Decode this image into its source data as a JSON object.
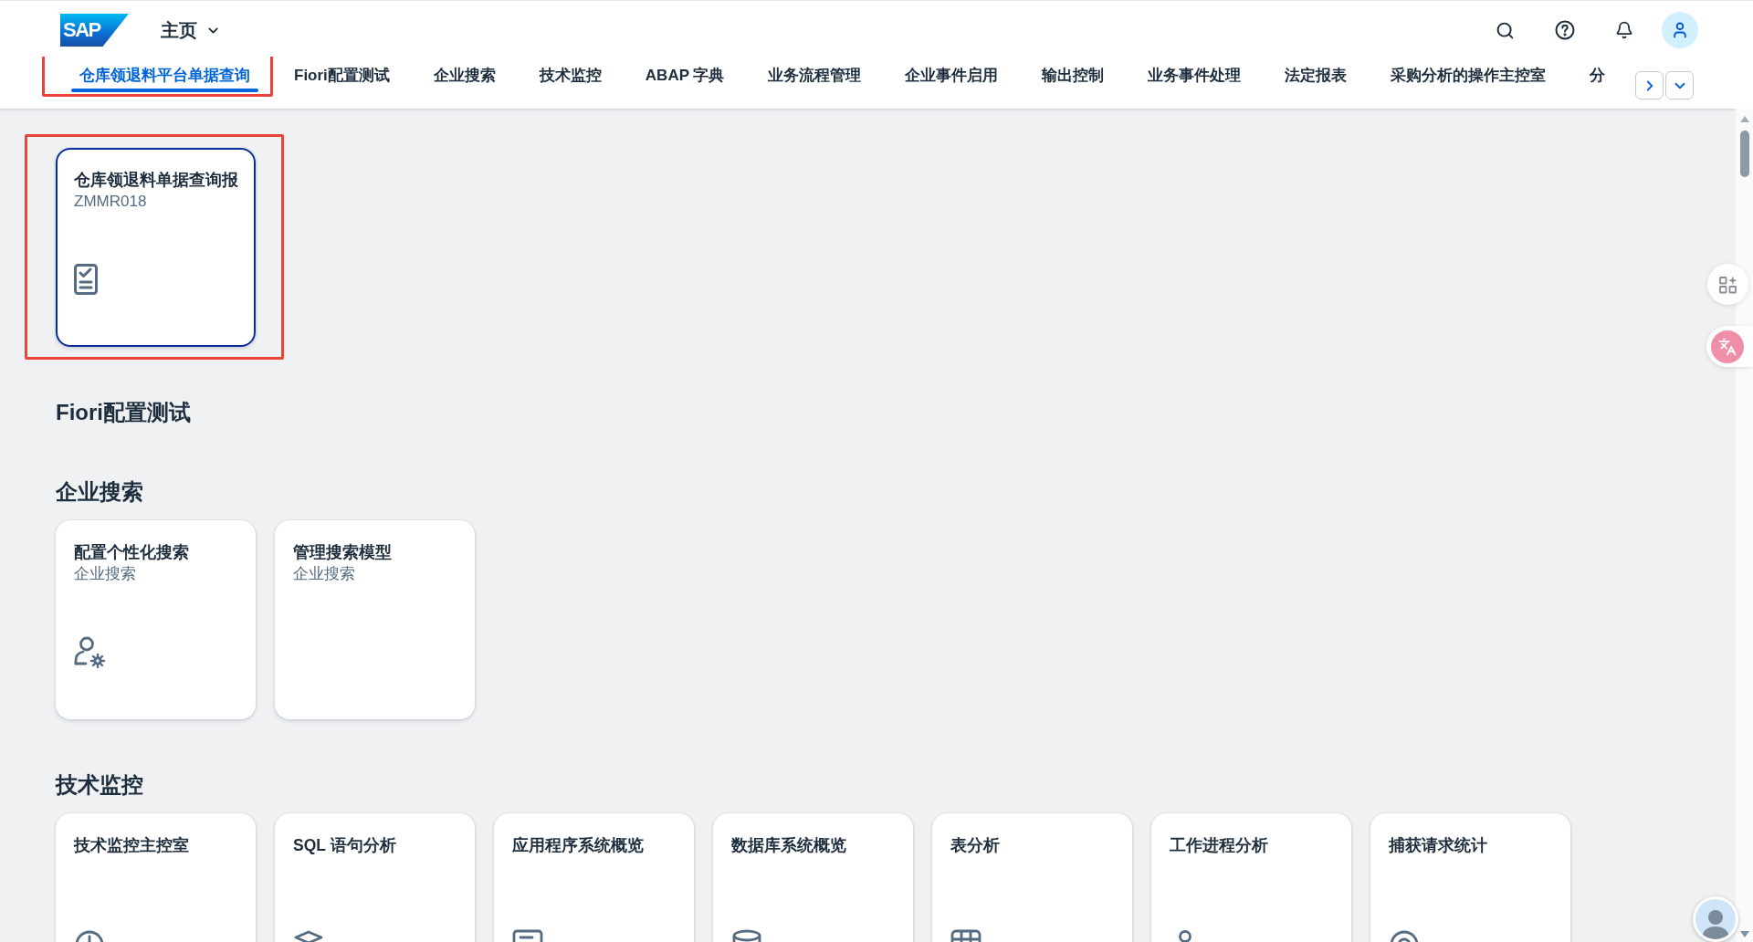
{
  "shell_bar": {
    "logo": "SAP",
    "title": "主页"
  },
  "tabs": [
    {
      "label": "仓库领退料平台单据查询",
      "selected": true,
      "highlighted": true
    },
    {
      "label": "Fiori配置测试",
      "selected": false,
      "highlighted": false
    },
    {
      "label": "企业搜索",
      "selected": false,
      "highlighted": false
    },
    {
      "label": "技术监控",
      "selected": false,
      "highlighted": false
    },
    {
      "label": "ABAP 字典",
      "selected": false,
      "highlighted": false
    },
    {
      "label": "业务流程管理",
      "selected": false,
      "highlighted": false
    },
    {
      "label": "企业事件启用",
      "selected": false,
      "highlighted": false
    },
    {
      "label": "输出控制",
      "selected": false,
      "highlighted": false
    },
    {
      "label": "业务事件处理",
      "selected": false,
      "highlighted": false
    },
    {
      "label": "法定报表",
      "selected": false,
      "highlighted": false
    },
    {
      "label": "采购分析的操作主控室",
      "selected": false,
      "highlighted": false
    },
    {
      "label": "分",
      "selected": false,
      "highlighted": false
    }
  ],
  "sections": [
    {
      "tiles": [
        {
          "title": "仓库领退料单据查询报",
          "subtitle": "ZMMR018",
          "focused": true,
          "highlighted": true
        }
      ]
    },
    {
      "title": "Fiori配置测试"
    },
    {
      "title": "企业搜索",
      "tiles": [
        {
          "title": "配置个性化搜索",
          "subtitle": "企业搜索",
          "focused": false,
          "highlighted": false
        },
        {
          "title": "管理搜索模型",
          "subtitle": "企业搜索",
          "focused": false,
          "highlighted": false
        }
      ]
    },
    {
      "title": "技术监控",
      "tiles": [
        {
          "title": "技术监控主控室",
          "focused": false,
          "highlighted": false
        },
        {
          "title": "SQL 语句分析",
          "focused": false,
          "highlighted": false
        },
        {
          "title": "应用程序系统概览",
          "focused": false,
          "highlighted": false
        },
        {
          "title": "数据库系统概览",
          "focused": false,
          "highlighted": false
        },
        {
          "title": "表分析",
          "focused": false,
          "highlighted": false
        },
        {
          "title": "工作进程分析",
          "focused": false,
          "highlighted": false
        },
        {
          "title": "捕获请求统计",
          "focused": false,
          "highlighted": false
        }
      ]
    }
  ]
}
